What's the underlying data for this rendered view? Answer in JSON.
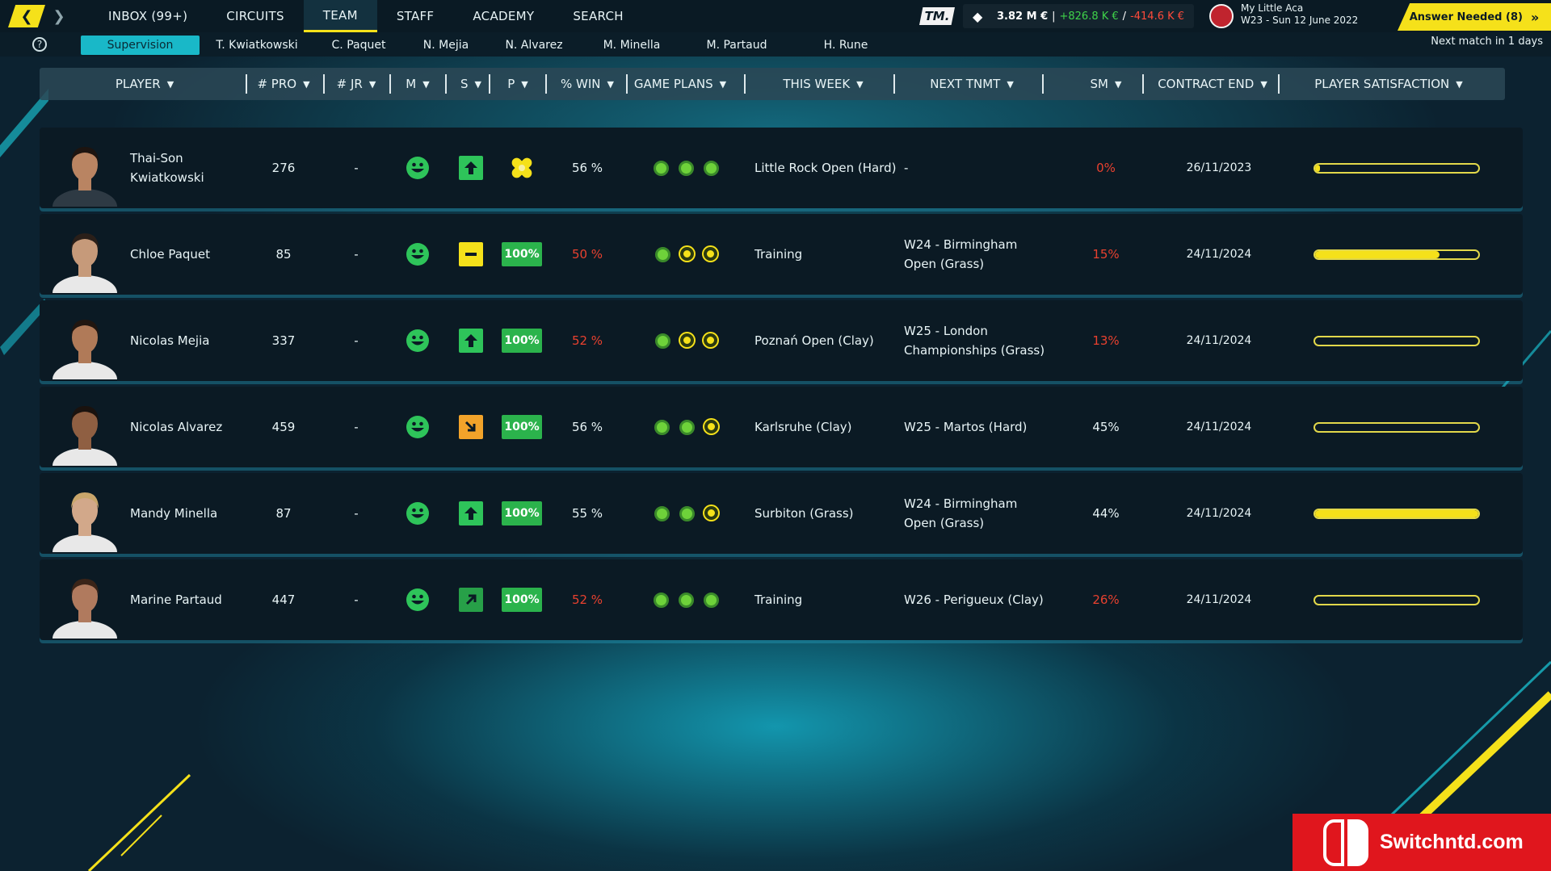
{
  "nav": {
    "back_icon": "chevron-left-icon",
    "forward_icon": "chevron-right-icon"
  },
  "menu": [
    {
      "label": "INBOX (99+)"
    },
    {
      "label": "CIRCUITS"
    },
    {
      "label": "TEAM",
      "active": true
    },
    {
      "label": "STAFF"
    },
    {
      "label": "ACADEMY"
    },
    {
      "label": "SEARCH"
    }
  ],
  "logo": "TM.",
  "finance": {
    "total": "3.82 M €",
    "sep1": "|",
    "income": "+826.8 K €",
    "sep2": "/",
    "expense": "-414.6 K €"
  },
  "club": {
    "name": "My Little Aca",
    "date": "W23 - Sun 12 June 2022"
  },
  "answer": {
    "label": "Answer Needed (8)",
    "chevron": "»"
  },
  "help": "?",
  "subtabs": [
    {
      "label": "Supervision",
      "active": true
    },
    {
      "label": "T. Kwiatkowski"
    },
    {
      "label": "C. Paquet"
    },
    {
      "label": "N. Mejia"
    },
    {
      "label": "N. Alvarez"
    },
    {
      "label": "M. Minella"
    },
    {
      "label": "M. Partaud"
    },
    {
      "label": "H. Rune"
    }
  ],
  "next_match": "Next match in 1 days",
  "columns": [
    "PLAYER",
    "# PRO",
    "# JR",
    "M",
    "S",
    "P",
    "% WIN",
    "GAME PLANS",
    "THIS WEEK",
    "NEXT TNMT",
    "SM",
    "CONTRACT END",
    "PLAYER SATISFACTION"
  ],
  "colors": {
    "accent": "#f5e11a",
    "good": "#2ec45a",
    "bad": "#e8412f",
    "cyan": "#19b8c8"
  },
  "players": [
    {
      "name": "Thai-Son Kwiatkowski",
      "pro": "276",
      "jr": "-",
      "mood": "happy",
      "trend": "up",
      "p": "injury",
      "win": "56 %",
      "win_red": false,
      "plans": [
        "g",
        "g",
        "g"
      ],
      "week": "Little Rock Open (Hard)",
      "next": "-",
      "sm": "0%",
      "sm_red": true,
      "contract": "26/11/2023",
      "satisfaction": 0.03
    },
    {
      "name": "Chloe Paquet",
      "pro": "85",
      "jr": "-",
      "mood": "happy",
      "trend": "flat",
      "p": "100%",
      "win": "50 %",
      "win_red": true,
      "plans": [
        "g",
        "y",
        "y"
      ],
      "week": "Training",
      "next": "W24 - Birmingham Open (Grass)",
      "sm": "15%",
      "sm_red": true,
      "contract": "24/11/2024",
      "satisfaction": 0.76
    },
    {
      "name": "Nicolas Mejia",
      "pro": "337",
      "jr": "-",
      "mood": "happy",
      "trend": "up",
      "p": "100%",
      "win": "52 %",
      "win_red": true,
      "plans": [
        "g",
        "y",
        "y"
      ],
      "week": "Poznań Open (Clay)",
      "next": "W25 - London Championships (Grass)",
      "sm": "13%",
      "sm_red": true,
      "contract": "24/11/2024",
      "satisfaction": 0
    },
    {
      "name": "Nicolas Alvarez",
      "pro": "459",
      "jr": "-",
      "mood": "happy",
      "trend": "down",
      "p": "100%",
      "win": "56 %",
      "win_red": false,
      "plans": [
        "g",
        "g",
        "y"
      ],
      "week": "Karlsruhe (Clay)",
      "next": "W25 -  Martos (Hard)",
      "sm": "45%",
      "sm_red": false,
      "contract": "24/11/2024",
      "satisfaction": 0
    },
    {
      "name": "Mandy Minella",
      "pro": "87",
      "jr": "-",
      "mood": "happy",
      "trend": "up",
      "p": "100%",
      "win": "55 %",
      "win_red": false,
      "plans": [
        "g",
        "g",
        "y"
      ],
      "week": "Surbiton (Grass)",
      "next": "W24 - Birmingham Open (Grass)",
      "sm": "44%",
      "sm_red": false,
      "contract": "24/11/2024",
      "satisfaction": 1.0
    },
    {
      "name": "Marine Partaud",
      "pro": "447",
      "jr": "-",
      "mood": "happy",
      "trend": "diag",
      "p": "100%",
      "win": "52 %",
      "win_red": true,
      "plans": [
        "g",
        "g",
        "g"
      ],
      "week": "Training",
      "next": "W26 -  Perigueux (Clay)",
      "sm": "26%",
      "sm_red": true,
      "contract": "24/11/2024",
      "satisfaction": 0
    }
  ],
  "watermark": "Switchntd.com"
}
